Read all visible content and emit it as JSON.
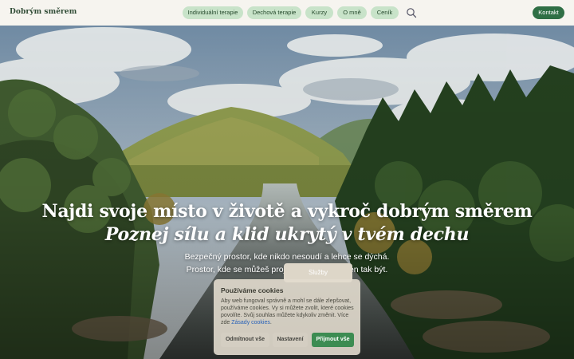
{
  "header": {
    "logo": "Dobrým směrem",
    "nav": [
      {
        "label": "Individuální terapie",
        "name": "nav-individual-therapy"
      },
      {
        "label": "Dechová terapie",
        "name": "nav-breath-therapy"
      },
      {
        "label": "Kurzy",
        "name": "nav-courses"
      },
      {
        "label": "O mně",
        "name": "nav-about"
      },
      {
        "label": "Ceník",
        "name": "nav-pricing"
      }
    ],
    "search_icon": "search-icon",
    "contact_label": "Kontakt"
  },
  "hero": {
    "title_line1": "Najdi svoje místo v životě a vykroč dobrým směrem",
    "title_line2": "Poznej sílu a klid ukrytý v tvém dechu",
    "subtitle_line1": "Bezpečný prostor, kde nikdo nesoudí a lehce se dýchá.",
    "subtitle_line2": "Prostor, kde se můžeš projevit. Kde můžeš jen tak být.",
    "services_button_label": "Služby"
  },
  "cookie_banner": {
    "title": "Používáme cookies",
    "text": "Aby web fungoval správně a mohl se dále zlepšovat, používáme cookies. Vy si můžete zvolit, které cookies povolíte. Svůj souhlas můžete kdykoliv změnit. Více zde",
    "link_label": "Zásady cookies",
    "decline_label": "Odmítnout vše",
    "settings_label": "Nastavení",
    "accept_label": "Přijmout vše"
  },
  "colors": {
    "nav_pill_bg": "#c8e3c9",
    "accent_green": "#2f6f45",
    "accept_green": "#3c8c52"
  }
}
